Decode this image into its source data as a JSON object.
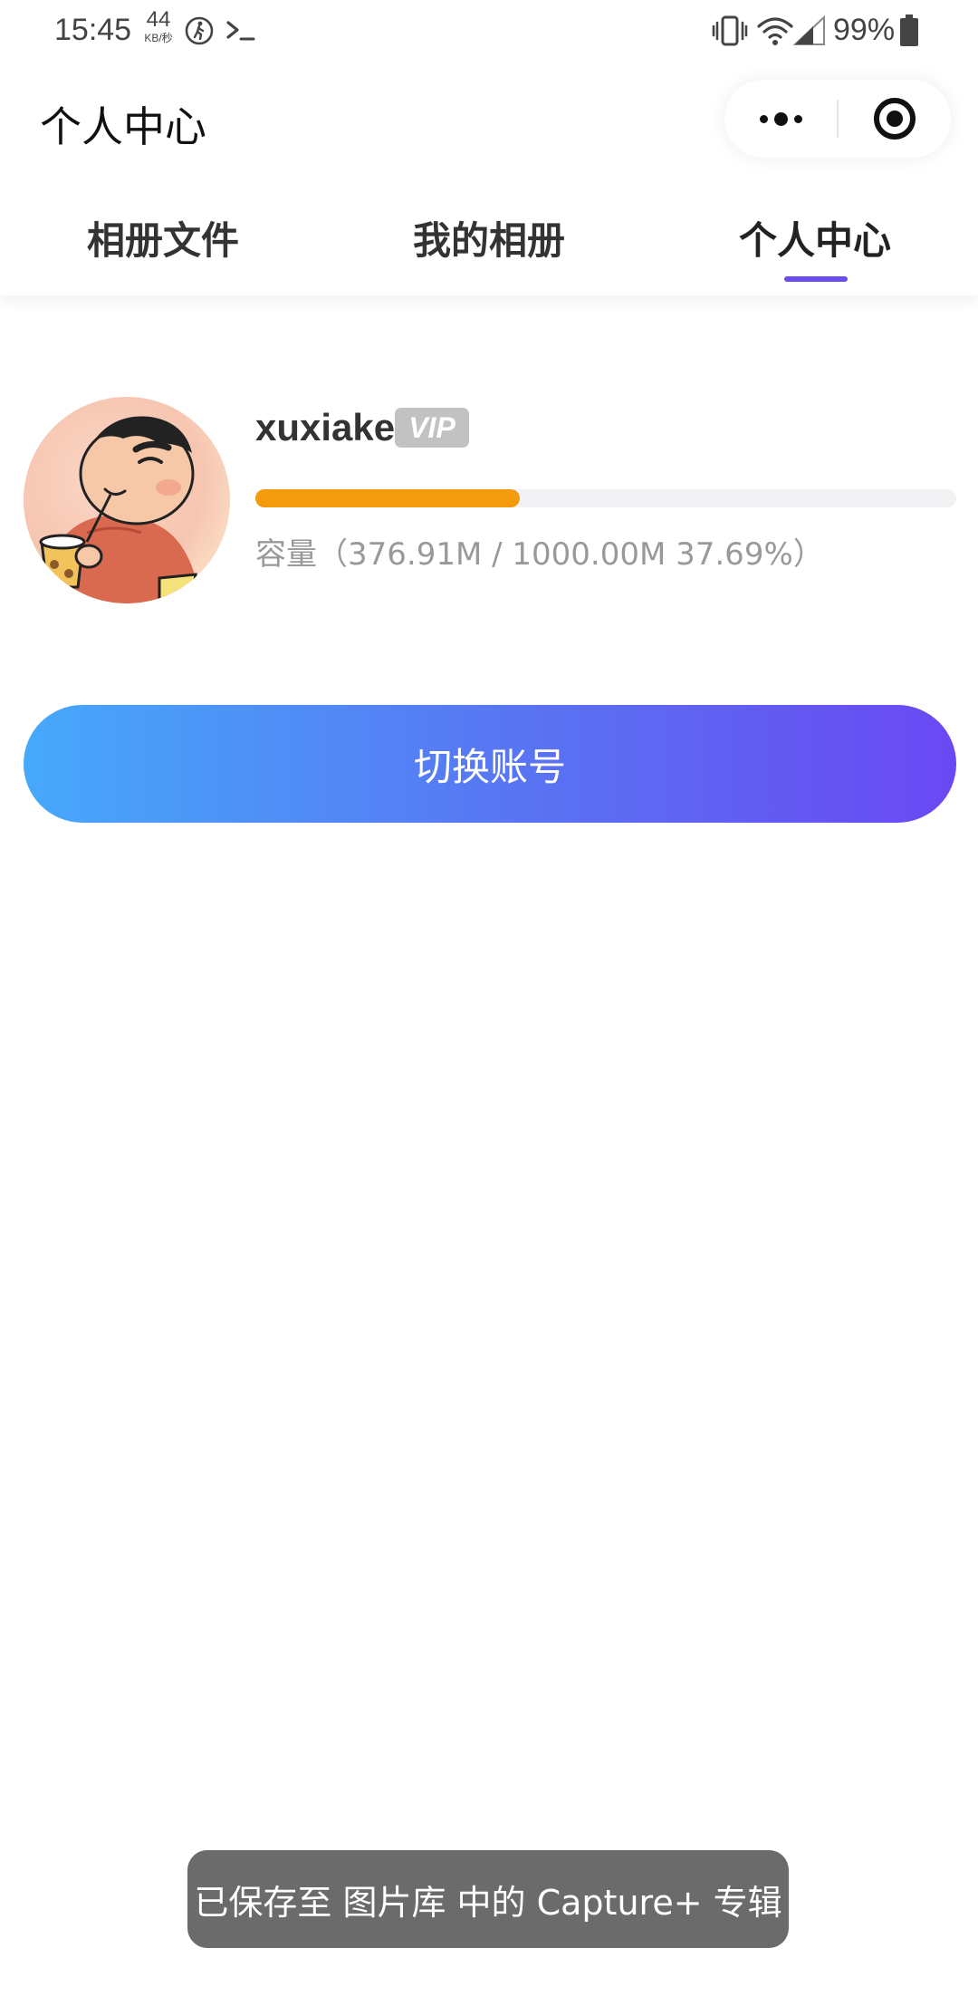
{
  "status_bar": {
    "time": "15:45",
    "net_speed_value": "44",
    "net_speed_unit": "KB/秒",
    "battery": "99%",
    "icons": [
      "walking-icon",
      "terminal-icon",
      "vibrate-icon",
      "wifi-icon",
      "signal-icon",
      "battery-icon"
    ]
  },
  "nav": {
    "title": "个人中心",
    "capsule_icons": [
      "more-icon",
      "target-icon"
    ]
  },
  "tabs": [
    {
      "label": "相册文件",
      "active": false
    },
    {
      "label": "我的相册",
      "active": false
    },
    {
      "label": "个人中心",
      "active": true
    }
  ],
  "profile": {
    "username": "xuxiake",
    "badge": "VIP",
    "usage_fraction": 0.3769,
    "capacity_text": "容量（376.91M / 1000.00M 37.69%）"
  },
  "actions": {
    "switch_account_label": "切换账号"
  },
  "toast": {
    "message": "已保存至 图片库 中的 Capture+ 专辑"
  },
  "colors": {
    "accent": "#6a4cf0",
    "progress": "#f39a0d",
    "button_gradient_start": "#46a9fb",
    "button_gradient_end": "#6a48f3",
    "badge_bg": "#c2c2c2",
    "toast_bg": "#6b6b6b"
  }
}
